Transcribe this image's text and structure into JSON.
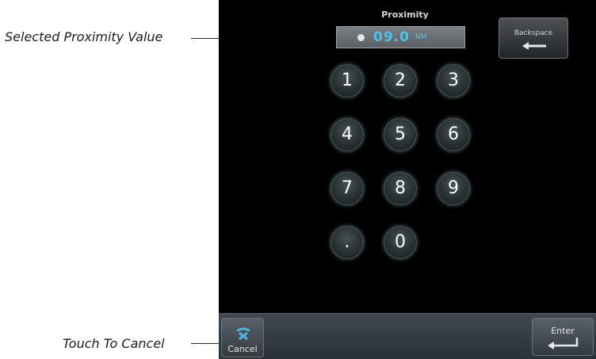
{
  "annotations": {
    "selected_value": "Selected Proximity Value",
    "touch_cancel": "Touch To Cancel"
  },
  "screen": {
    "title": "Proximity",
    "field": {
      "value": "09.0",
      "unit": "NM"
    },
    "backspace": {
      "label": "Backspace",
      "icon": "left-arrow-icon"
    },
    "keypad": [
      "1",
      "2",
      "3",
      "4",
      "5",
      "6",
      "7",
      "8",
      "9",
      ".",
      "0"
    ],
    "bottom_bar": {
      "cancel_label": "Cancel",
      "cancel_icon": "cancel-icon",
      "enter_label": "Enter",
      "enter_icon": "enter-return-icon"
    }
  },
  "colors": {
    "value_text": "#4fc3e6",
    "screen_background": "#000000"
  }
}
